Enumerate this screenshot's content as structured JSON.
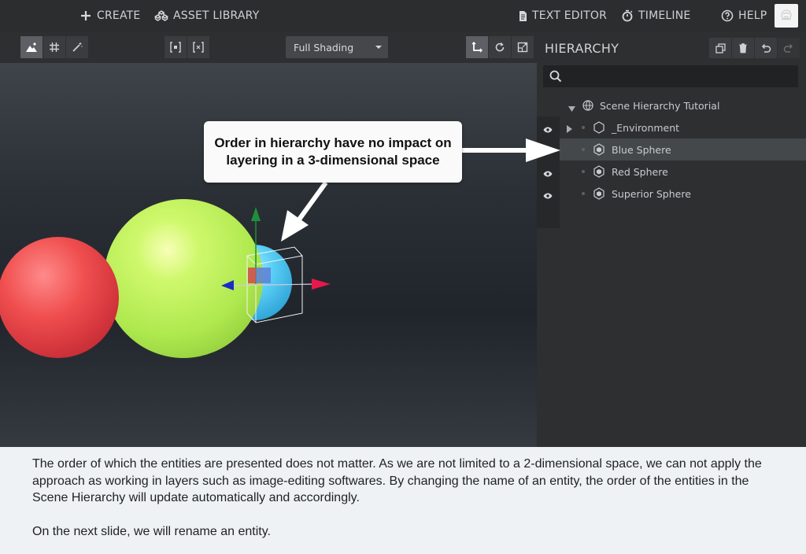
{
  "topbar": {
    "create_label": "CREATE",
    "asset_library_label": "ASSET LIBRARY",
    "text_editor_label": "TEXT EDITOR",
    "timeline_label": "TIMELINE",
    "help_label": "HELP"
  },
  "toolbar": {
    "shading_value": "Full Shading",
    "icons": [
      "scene-view-icon",
      "grid-icon",
      "magic-wand-icon",
      "frame-selection-icon",
      "frame-all-icon",
      "translate-icon",
      "rotate-icon",
      "scale-icon"
    ]
  },
  "hierarchy": {
    "title": "HIERARCHY",
    "search_placeholder": "",
    "items": [
      {
        "label": "Scene Hierarchy Tutorial",
        "icon": "globe-icon",
        "expanded": true
      },
      {
        "label": "_Environment",
        "icon": "hexagon-icon",
        "expanded": false
      },
      {
        "label": "Blue Sphere",
        "icon": "entity-icon",
        "selected": true
      },
      {
        "label": "Red Sphere",
        "icon": "entity-icon"
      },
      {
        "label": "Superior Sphere",
        "icon": "entity-icon"
      }
    ]
  },
  "callout": {
    "line1": "Order in hierarchy have no impact on",
    "line2": "layering in a 3-dimensional space"
  },
  "caption": {
    "paragraph1": "The order of which the entities are presented does not matter. As we are not limited to a 2-dimensional space, we can not apply the approach as working in layers such as image-editing softwares. By changing the name of an entity, the order of the entities in the Scene Hierarchy will update automatically and accordingly.",
    "paragraph2": "On the next slide, we will rename an entity."
  },
  "colors": {
    "accent_red": "#ef4a4a",
    "accent_green": "#b4ec54",
    "accent_blue": "#55cdf4",
    "gizmo_green": "#1f8f3a",
    "gizmo_red": "#e8184a",
    "gizmo_blue": "#1a2cc4"
  }
}
